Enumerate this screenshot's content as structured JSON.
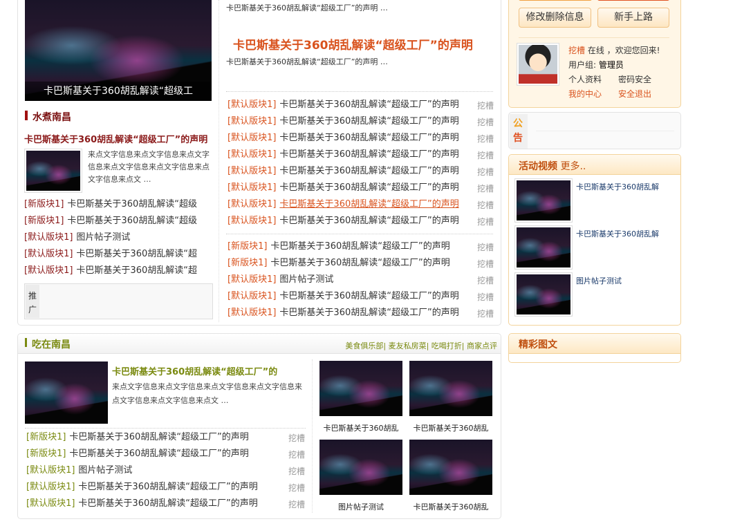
{
  "left": {
    "hero_caption": "卡巴斯基关于360胡乱解读“超级工",
    "section_title": "水煮南昌",
    "feature_title": "卡巴斯基关于360胡乱解读“超级工厂”的声明",
    "feature_text": "来点文字信息来点文字信息来点文字信息来点文字信息来点文字信息来点文字信息来点文 …",
    "list": [
      {
        "tag": "[新版块1]",
        "title": "卡巴斯基关于360胡乱解读“超级"
      },
      {
        "tag": "[新版块1]",
        "title": "卡巴斯基关于360胡乱解读“超级"
      },
      {
        "tag": "[默认版块1]",
        "title": "图片帖子测试"
      },
      {
        "tag": "[默认版块1]",
        "title": "卡巴斯基关于360胡乱解读“超"
      },
      {
        "tag": "[默认版块1]",
        "title": "卡巴斯基关于360胡乱解读“超"
      }
    ],
    "promo_label": "推广"
  },
  "center": {
    "summary1": "卡巴斯基关于360胡乱解读“超级工厂”的声明 …",
    "headline": "卡巴斯基关于360胡乱解读“超级工厂”的声明",
    "summary2": "卡巴斯基关于360胡乱解读“超级工厂”的声明 …",
    "list1": [
      {
        "tag": "[默认版块1]",
        "title": "卡巴斯基关于360胡乱解读“超级工厂”的声明",
        "author": "挖槽"
      },
      {
        "tag": "[默认版块1]",
        "title": "卡巴斯基关于360胡乱解读“超级工厂”的声明",
        "author": "挖槽"
      },
      {
        "tag": "[默认版块1]",
        "title": "卡巴斯基关于360胡乱解读“超级工厂”的声明",
        "author": "挖槽"
      },
      {
        "tag": "[默认版块1]",
        "title": "卡巴斯基关于360胡乱解读“超级工厂”的声明",
        "author": "挖槽"
      },
      {
        "tag": "[默认版块1]",
        "title": "卡巴斯基关于360胡乱解读“超级工厂”的声明",
        "author": "挖槽"
      },
      {
        "tag": "[默认版块1]",
        "title": "卡巴斯基关于360胡乱解读“超级工厂”的声明",
        "author": "挖槽"
      },
      {
        "tag": "[默认版块1]",
        "title": "卡巴斯基关于360胡乱解读“超级工厂”的声明",
        "author": "挖槽",
        "hover": true
      },
      {
        "tag": "[默认版块1]",
        "title": "卡巴斯基关于360胡乱解读“超级工厂”的声明",
        "author": "挖槽"
      }
    ],
    "list2": [
      {
        "tag": "[新版块1]",
        "title": "卡巴斯基关于360胡乱解读“超级工厂”的声明",
        "author": "挖槽"
      },
      {
        "tag": "[新版块1]",
        "title": "卡巴斯基关于360胡乱解读“超级工厂”的声明",
        "author": "挖槽"
      },
      {
        "tag": "[默认版块1]",
        "title": "图片帖子测试",
        "author": "挖槽"
      },
      {
        "tag": "[默认版块1]",
        "title": "卡巴斯基关于360胡乱解读“超级工厂”的声明",
        "author": "挖槽"
      },
      {
        "tag": "[默认版块1]",
        "title": "卡巴斯基关于360胡乱解读“超级工厂”的声明",
        "author": "挖槽"
      }
    ]
  },
  "user": {
    "edit_button": "修改删除信息",
    "newbie_button": "新手上路",
    "name": "挖槽",
    "status": "在线 ，欢迎您回来!",
    "group_label": "用户组:",
    "group": "管理员",
    "profile": "个人资料",
    "password": "密码安全",
    "my_center": "我的中心",
    "logout": "安全退出"
  },
  "notice": {
    "label1": "公",
    "label2": "告"
  },
  "video": {
    "title": "活动视频",
    "more": "更多..",
    "items": [
      "卡巴斯基关于360胡乱解",
      "卡巴斯基关于360胡乱解",
      "图片帖子测试"
    ]
  },
  "gallery": {
    "title": "精彩图文"
  },
  "food": {
    "title": "吃在南昌",
    "links": [
      "美食俱乐部",
      "麦友私房菜",
      "吃喝打折",
      "商家点评"
    ],
    "feature_title": "卡巴斯基关于360胡乱解读“超级工厂”的",
    "feature_text": "来点文字信息来点文字信息来点文字信息来点文字信息来点文字信息来点文字信息来点文 …",
    "list": [
      {
        "tag": "[新版块1]",
        "title": "卡巴斯基关于360胡乱解读“超级工厂”的声明",
        "author": "挖槽"
      },
      {
        "tag": "[新版块1]",
        "title": "卡巴斯基关于360胡乱解读“超级工厂”的声明",
        "author": "挖槽"
      },
      {
        "tag": "[默认版块1]",
        "title": "图片帖子测试",
        "author": "挖槽"
      },
      {
        "tag": "[默认版块1]",
        "title": "卡巴斯基关于360胡乱解读“超级工厂”的声明",
        "author": "挖槽"
      },
      {
        "tag": "[默认版块1]",
        "title": "卡巴斯基关于360胡乱解读“超级工厂”的声明",
        "author": "挖槽"
      }
    ],
    "thumbs": [
      "卡巴斯基关于360胡乱",
      "卡巴斯基关于360胡乱",
      "图片帖子测试",
      "卡巴斯基关于360胡乱"
    ]
  }
}
